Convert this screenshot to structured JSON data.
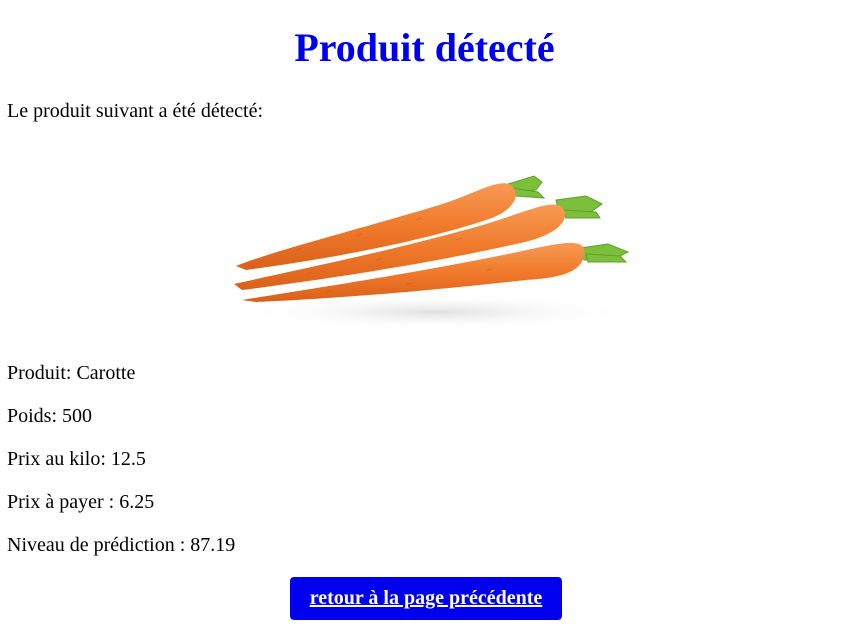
{
  "page": {
    "title": "Produit détecté",
    "intro": "Le produit suivant a été détecté:"
  },
  "image": {
    "icon": "carrot-photo",
    "alt": "Carotte"
  },
  "details": {
    "product": "Produit: Carotte",
    "weight": "Poids: 500",
    "price_per_kilo": "Prix au kilo: 12.5",
    "price_to_pay": "Prix à payer : 6.25",
    "prediction_level": "Niveau de prédiction : 87.19"
  },
  "actions": {
    "back_label": "retour à la page précédente"
  },
  "colors": {
    "title": "#0000ee",
    "button_bg": "#0000ee",
    "button_text": "#ffffff",
    "carrot_orange": "#f07a2b",
    "carrot_leaves": "#7cbf3a"
  }
}
